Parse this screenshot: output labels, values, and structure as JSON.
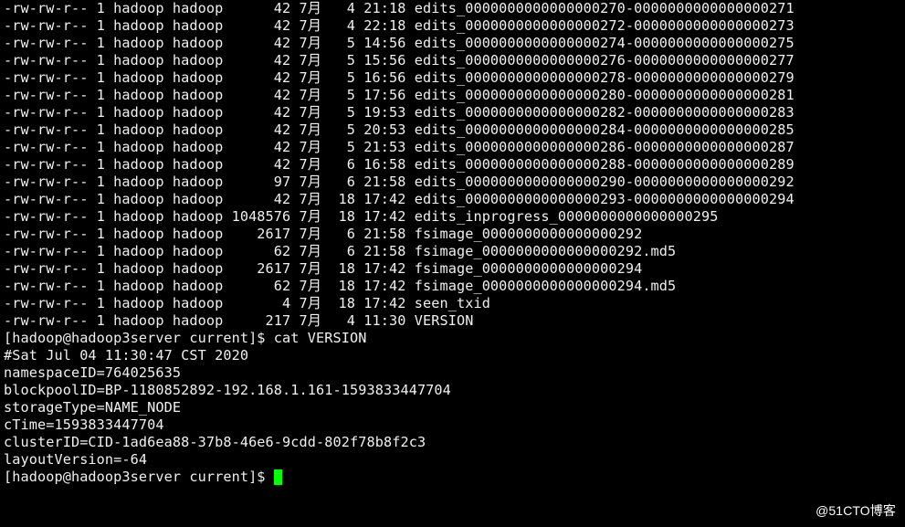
{
  "listing": [
    {
      "perms": "-rw-rw-r--",
      "links": "1",
      "owner": "hadoop",
      "group": "hadoop",
      "size": "42",
      "month": "7月",
      "day": "4",
      "time": "21:18",
      "name": "edits_0000000000000000270-0000000000000000271"
    },
    {
      "perms": "-rw-rw-r--",
      "links": "1",
      "owner": "hadoop",
      "group": "hadoop",
      "size": "42",
      "month": "7月",
      "day": "4",
      "time": "22:18",
      "name": "edits_0000000000000000272-0000000000000000273"
    },
    {
      "perms": "-rw-rw-r--",
      "links": "1",
      "owner": "hadoop",
      "group": "hadoop",
      "size": "42",
      "month": "7月",
      "day": "5",
      "time": "14:56",
      "name": "edits_0000000000000000274-0000000000000000275"
    },
    {
      "perms": "-rw-rw-r--",
      "links": "1",
      "owner": "hadoop",
      "group": "hadoop",
      "size": "42",
      "month": "7月",
      "day": "5",
      "time": "15:56",
      "name": "edits_0000000000000000276-0000000000000000277"
    },
    {
      "perms": "-rw-rw-r--",
      "links": "1",
      "owner": "hadoop",
      "group": "hadoop",
      "size": "42",
      "month": "7月",
      "day": "5",
      "time": "16:56",
      "name": "edits_0000000000000000278-0000000000000000279"
    },
    {
      "perms": "-rw-rw-r--",
      "links": "1",
      "owner": "hadoop",
      "group": "hadoop",
      "size": "42",
      "month": "7月",
      "day": "5",
      "time": "17:56",
      "name": "edits_0000000000000000280-0000000000000000281"
    },
    {
      "perms": "-rw-rw-r--",
      "links": "1",
      "owner": "hadoop",
      "group": "hadoop",
      "size": "42",
      "month": "7月",
      "day": "5",
      "time": "19:53",
      "name": "edits_0000000000000000282-0000000000000000283"
    },
    {
      "perms": "-rw-rw-r--",
      "links": "1",
      "owner": "hadoop",
      "group": "hadoop",
      "size": "42",
      "month": "7月",
      "day": "5",
      "time": "20:53",
      "name": "edits_0000000000000000284-0000000000000000285"
    },
    {
      "perms": "-rw-rw-r--",
      "links": "1",
      "owner": "hadoop",
      "group": "hadoop",
      "size": "42",
      "month": "7月",
      "day": "5",
      "time": "21:53",
      "name": "edits_0000000000000000286-0000000000000000287"
    },
    {
      "perms": "-rw-rw-r--",
      "links": "1",
      "owner": "hadoop",
      "group": "hadoop",
      "size": "42",
      "month": "7月",
      "day": "6",
      "time": "16:58",
      "name": "edits_0000000000000000288-0000000000000000289"
    },
    {
      "perms": "-rw-rw-r--",
      "links": "1",
      "owner": "hadoop",
      "group": "hadoop",
      "size": "97",
      "month": "7月",
      "day": "6",
      "time": "21:58",
      "name": "edits_0000000000000000290-0000000000000000292"
    },
    {
      "perms": "-rw-rw-r--",
      "links": "1",
      "owner": "hadoop",
      "group": "hadoop",
      "size": "42",
      "month": "7月",
      "day": "18",
      "time": "17:42",
      "name": "edits_0000000000000000293-0000000000000000294"
    },
    {
      "perms": "-rw-rw-r--",
      "links": "1",
      "owner": "hadoop",
      "group": "hadoop",
      "size": "1048576",
      "month": "7月",
      "day": "18",
      "time": "17:42",
      "name": "edits_inprogress_0000000000000000295"
    },
    {
      "perms": "-rw-rw-r--",
      "links": "1",
      "owner": "hadoop",
      "group": "hadoop",
      "size": "2617",
      "month": "7月",
      "day": "6",
      "time": "21:58",
      "name": "fsimage_0000000000000000292"
    },
    {
      "perms": "-rw-rw-r--",
      "links": "1",
      "owner": "hadoop",
      "group": "hadoop",
      "size": "62",
      "month": "7月",
      "day": "6",
      "time": "21:58",
      "name": "fsimage_0000000000000000292.md5"
    },
    {
      "perms": "-rw-rw-r--",
      "links": "1",
      "owner": "hadoop",
      "group": "hadoop",
      "size": "2617",
      "month": "7月",
      "day": "18",
      "time": "17:42",
      "name": "fsimage_0000000000000000294"
    },
    {
      "perms": "-rw-rw-r--",
      "links": "1",
      "owner": "hadoop",
      "group": "hadoop",
      "size": "62",
      "month": "7月",
      "day": "18",
      "time": "17:42",
      "name": "fsimage_0000000000000000294.md5"
    },
    {
      "perms": "-rw-rw-r--",
      "links": "1",
      "owner": "hadoop",
      "group": "hadoop",
      "size": "4",
      "month": "7月",
      "day": "18",
      "time": "17:42",
      "name": "seen_txid"
    },
    {
      "perms": "-rw-rw-r--",
      "links": "1",
      "owner": "hadoop",
      "group": "hadoop",
      "size": "217",
      "month": "7月",
      "day": "4",
      "time": "11:30",
      "name": "VERSION"
    }
  ],
  "prompt1": "[hadoop@hadoop3server current]$ ",
  "command1": "cat VERSION",
  "file_contents": [
    "#Sat Jul 04 11:30:47 CST 2020",
    "namespaceID=764025635",
    "blockpoolID=BP-1180852892-192.168.1.161-1593833447704",
    "storageType=NAME_NODE",
    "cTime=1593833447704",
    "clusterID=CID-1ad6ea88-37b8-46e6-9cdd-802f78b8f2c3",
    "layoutVersion=-64"
  ],
  "prompt2": "[hadoop@hadoop3server current]$ ",
  "watermark": "@51CTO博客"
}
